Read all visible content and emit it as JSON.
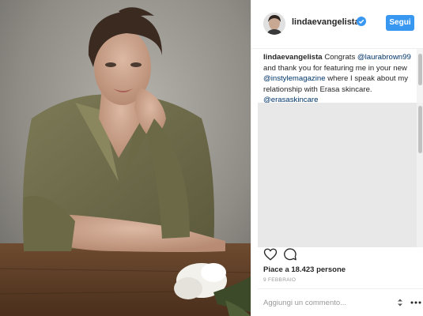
{
  "post": {
    "username": "lindaevangelista",
    "follow_label": "Segui",
    "caption": {
      "author": "lindaevangelista",
      "text_1": " Congrats ",
      "mention_1": "@laurabrown99",
      "text_2": " and thank you for featuring me in your new ",
      "mention_2": "@instylemagazine",
      "text_3": " where I speak about my relationship with Erasa skincare. ",
      "mention_3": "@erasaskincare"
    },
    "likes": "Piace a 18.423 persone",
    "date": "9 febbraio",
    "comment_placeholder": "Aggiungi un commento..."
  },
  "colors": {
    "accent": "#3897f0",
    "link": "#003569",
    "muted": "#999999"
  },
  "icons": [
    "verified-badge-icon",
    "heart-icon",
    "comment-icon",
    "stepper-icon",
    "more-options-icon"
  ]
}
